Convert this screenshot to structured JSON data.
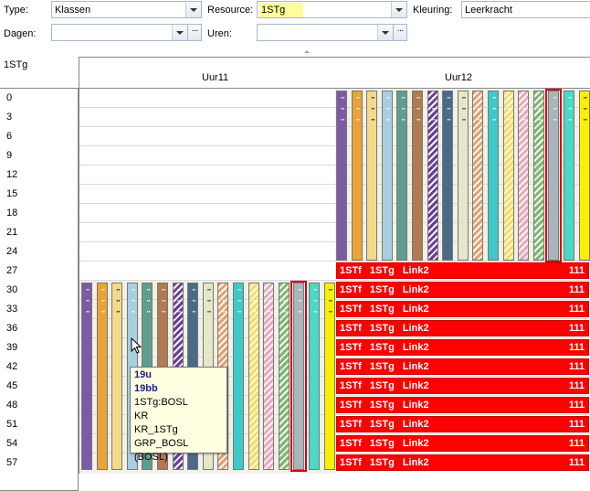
{
  "toolbar": {
    "type_label": "Type:",
    "type_value": "Klassen",
    "resource_label": "Resource:",
    "resource_value": "1STg",
    "kleuring_label": "Kleuring:",
    "kleuring_value": "Leerkracht",
    "dagen_label": "Dagen:",
    "dagen_value": "",
    "uren_label": "Uren:",
    "uren_value": "",
    "ellipsis": "···"
  },
  "resource_title": "1STg",
  "columns": [
    "Uur11",
    "Uur12"
  ],
  "row_labels": [
    "0",
    "3",
    "6",
    "9",
    "12",
    "15",
    "18",
    "21",
    "24",
    "27",
    "30",
    "33",
    "36",
    "39",
    "42",
    "45",
    "48",
    "51",
    "54",
    "57"
  ],
  "bar_colors": [
    "#7b5aa6",
    "#e8a33a",
    "#f3d98a",
    "#a8cfe0",
    "#5f9e8f",
    "#b07a52",
    "#6a3d9a",
    "#4a6a8a",
    "#e6e6c8",
    "#e0a070",
    "#3ec9c9",
    "#f6df58",
    "#e8a8c0",
    "#7ab870",
    "#aab4bc",
    "#4ad8c8",
    "#f8f000"
  ],
  "red_bars": [
    {
      "text": "1STf 1STg Link2",
      "num": "111"
    },
    {
      "text": "1STf 1STg Link2",
      "num": "111"
    },
    {
      "text": "1STf 1STg Link2",
      "num": "111"
    },
    {
      "text": "1STf 1STg Link2",
      "num": "111"
    },
    {
      "text": "1STf 1STg Link2",
      "num": "111"
    },
    {
      "text": "1STf 1STg Link2",
      "num": "111"
    },
    {
      "text": "1STf 1STg Link2",
      "num": "111"
    },
    {
      "text": "1STf 1STg Link2",
      "num": "111"
    },
    {
      "text": "1STf 1STg Link2",
      "num": "111"
    },
    {
      "text": "1STf 1STg Link2",
      "num": "111"
    },
    {
      "text": "1STf 1STg Link2",
      "num": "111"
    }
  ],
  "tooltip": {
    "line1": "19u",
    "line2": "19bb",
    "line3": "1STg:BOSL",
    "line4": "KR",
    "line5": "KR_1STg",
    "line6": "GRP_BOSL (BOSL)"
  },
  "colors": {
    "highlight": "#ffff99",
    "selection": "#d0021b",
    "red_bar": "#ff0000"
  }
}
